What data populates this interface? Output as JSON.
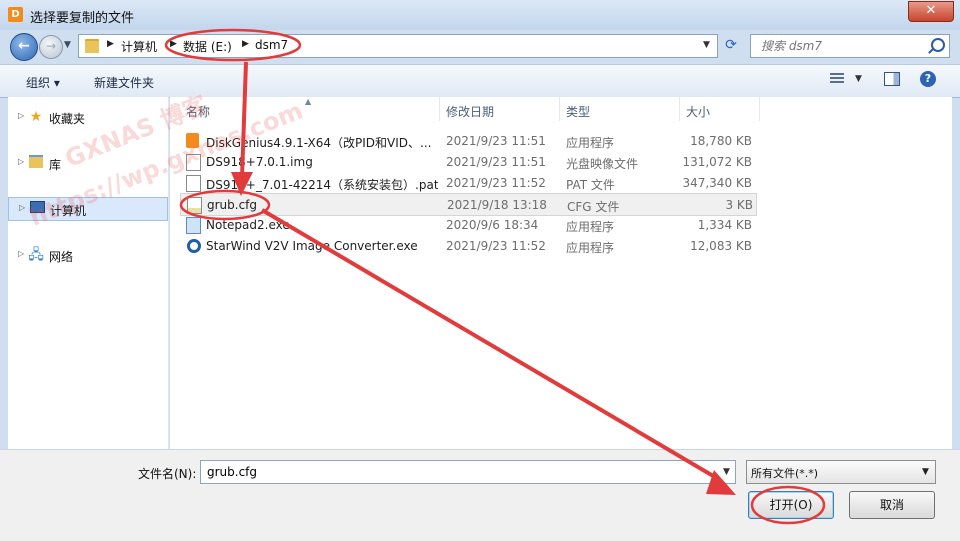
{
  "window": {
    "title": "选择要复制的文件",
    "close_label": "✕"
  },
  "address": {
    "crumbs": [
      "计算机",
      "数据 (E:)",
      "dsm7"
    ]
  },
  "search": {
    "placeholder": "搜索 dsm7"
  },
  "toolbar": {
    "organize_label": "组织 ▾",
    "new_folder_label": "新建文件夹",
    "help_label": "?"
  },
  "sidebar": {
    "items": [
      {
        "label": "收藏夹",
        "icon": "star-icon"
      },
      {
        "label": "库",
        "icon": "library-icon"
      },
      {
        "label": "计算机",
        "icon": "computer-icon",
        "selected": true
      },
      {
        "label": "网络",
        "icon": "network-icon"
      }
    ]
  },
  "columns": {
    "name": "名称",
    "modified": "修改日期",
    "type": "类型",
    "size": "大小"
  },
  "files": [
    {
      "name": "DiskGenius4.9.1-X64（改PID和VID、...",
      "modified": "2021/9/23 11:51",
      "type": "应用程序",
      "size": "18,780 KB",
      "icon": "app-icon"
    },
    {
      "name": "DS918+7.0.1.img",
      "modified": "2021/9/23 11:51",
      "type": "光盘映像文件",
      "size": "131,072 KB",
      "icon": "disk-image-icon"
    },
    {
      "name": "DS918+_7.01-42214（系统安装包）.pat",
      "modified": "2021/9/23 11:52",
      "type": "PAT 文件",
      "size": "347,340 KB",
      "icon": "file-icon"
    },
    {
      "name": "grub.cfg",
      "modified": "2021/9/18 13:18",
      "type": "CFG 文件",
      "size": "3 KB",
      "icon": "cfg-file-icon",
      "highlighted": true
    },
    {
      "name": "Notepad2.exe",
      "modified": "2020/9/6 18:34",
      "type": "应用程序",
      "size": "1,334 KB",
      "icon": "notepad-icon"
    },
    {
      "name": "StarWind V2V Image Converter.exe",
      "modified": "2021/9/23 11:52",
      "type": "应用程序",
      "size": "12,083 KB",
      "icon": "starwind-icon"
    }
  ],
  "bottom": {
    "filename_label": "文件名(N):",
    "filename_value": "grub.cfg",
    "filetype_value": "所有文件(*.*)",
    "open_label": "打开(O)",
    "cancel_label": "取消"
  },
  "watermark": {
    "line1": "GXNAS 博客",
    "line2": "https://wp.gxnas.com"
  },
  "colors": {
    "annotation": "#e23b3b",
    "selection": "#d9e8fb",
    "titlebar": "#c3d6ec"
  }
}
